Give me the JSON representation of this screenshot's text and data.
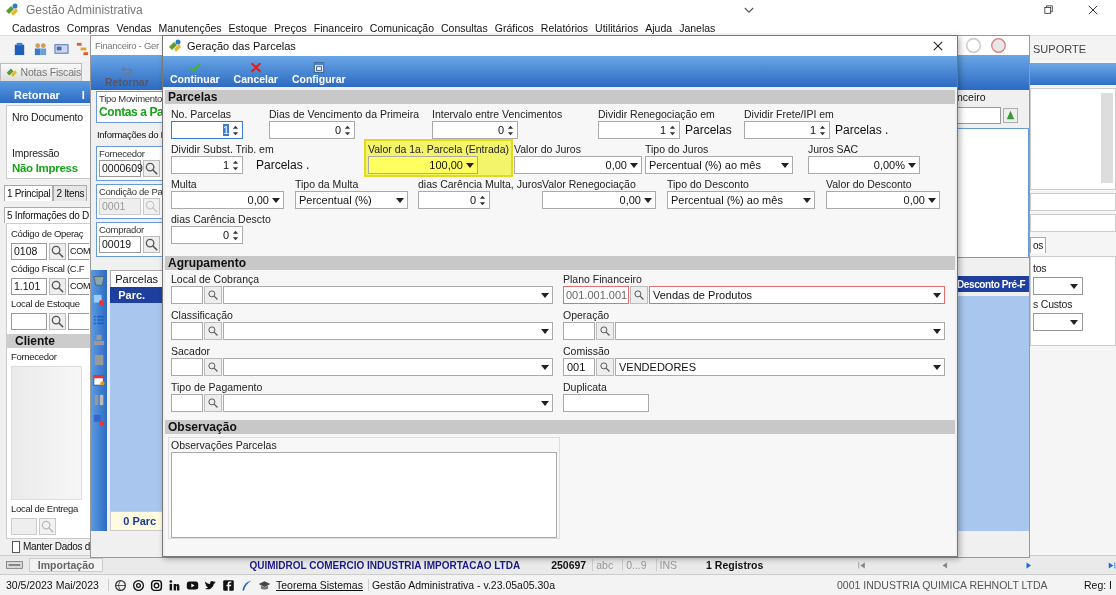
{
  "app": {
    "title": "Gestão Administrativa",
    "menu": [
      "Cadastros",
      "Compras",
      "Vendas",
      "Manutenções",
      "Estoque",
      "Preços",
      "Financeiro",
      "Comunicação",
      "Consultas",
      "Gráficos",
      "Relatórios",
      "Utilitários",
      "Ajuda",
      "Janelas"
    ],
    "support_label": "SUPORTE"
  },
  "notas_fiscais": {
    "title": "Notas Fiscais",
    "toolbar": [
      "Retornar",
      "I"
    ],
    "document_label": "Nro Documento",
    "print_label": "Impressão",
    "print_status": "Não Impress",
    "tabs": [
      {
        "label": "1 Principal",
        "selected": true
      },
      {
        "label": "2 Itens",
        "selected": false
      }
    ],
    "subtab": "5 Informações do D",
    "fields": [
      {
        "label": "Código de Operaç",
        "code": "0108",
        "description": "COM"
      },
      {
        "label": "Código Fiscal (C.F",
        "code": "1.101",
        "description": "COM"
      },
      {
        "label": "Local de Estoque"
      }
    ],
    "section": "Cliente",
    "supplier_label": "Fornecedor",
    "delivery_label": "Local de Entrega",
    "keep_data": {
      "label": "Manter Dados d",
      "checked": false
    },
    "bottom_tab": "Importação"
  },
  "financeiro": {
    "title": "Financeiro - Ger",
    "toolbar_button": "Retornar",
    "movement_label": "Tipo Movimento",
    "movement_value": "Contas a Pa",
    "info_tab": "Informações do I",
    "groups": [
      {
        "label": "Fornecedor",
        "code": "0000609",
        "disabled": false
      },
      {
        "label": "Condição de Pa",
        "code": "0001",
        "disabled": true
      },
      {
        "label": "Comprador",
        "code": "00019",
        "disabled": false
      }
    ],
    "grid_tab": "Parcelas",
    "grid_column": "Parc.",
    "grid_footer": "0 Parc",
    "right_group_label": "nceiro",
    "right_column": "Desconto Pré-F"
  },
  "right_panel": {
    "tab": "os",
    "fields": [
      "tos",
      "s Custos"
    ]
  },
  "dialog": {
    "title": "Geração das Parcelas",
    "toolbar": [
      {
        "label": "Continuar",
        "kind": "confirm"
      },
      {
        "label": "Cancelar",
        "kind": "cancel"
      },
      {
        "label": "Configurar",
        "kind": "configure"
      }
    ],
    "parcelas": {
      "title": "Parcelas",
      "rows": [
        [
          {
            "label": "No. Parcelas",
            "value": "1",
            "kind": "spin",
            "highlighted": false,
            "focused": true
          },
          {
            "label": "Dias de Vencimento da Primeira",
            "value": "0",
            "kind": "spin",
            "highlighted": false,
            "focused": false
          },
          {
            "label": "Intervalo entre Vencimentos",
            "value": "0",
            "kind": "spin",
            "highlighted": false,
            "focused": false
          },
          {
            "label": "Dividir Renegociação em",
            "value": "1",
            "kind": "spin",
            "suffix": "Parcelas",
            "highlighted": false,
            "focused": false
          },
          {
            "label": "Dividir Frete/IPI em",
            "value": "1",
            "kind": "spin",
            "suffix": "Parcelas .",
            "highlighted": false,
            "focused": false
          }
        ],
        [
          {
            "label": "Dividir Subst. Trib. em",
            "value": "1",
            "kind": "spin",
            "suffix": "Parcelas .",
            "highlighted": false,
            "focused": false
          },
          {
            "label": "Valor da 1a. Parcela (Entrada)",
            "value": "100,00",
            "kind": "amount",
            "highlighted": true,
            "focused": false
          },
          {
            "label": "Valor do Juros",
            "value": "0,00",
            "kind": "amount",
            "highlighted": false,
            "focused": false
          },
          {
            "label": "Tipo do Juros",
            "value": "Percentual (%)  ao mês",
            "kind": "select",
            "highlighted": false,
            "focused": false
          },
          {
            "label": "Juros SAC",
            "value": "0,00%",
            "kind": "amount",
            "highlighted": false,
            "focused": false
          }
        ],
        [
          {
            "label": "Multa",
            "value": "0,00",
            "kind": "amount",
            "highlighted": false,
            "focused": false
          },
          {
            "label": "Tipo da Multa",
            "value": "Percentual (%)",
            "kind": "select",
            "highlighted": false,
            "focused": false
          },
          {
            "label": "dias Carência Multa, Juros",
            "value": "0",
            "kind": "spin",
            "highlighted": false,
            "focused": false
          },
          {
            "label": "Valor Renegociação",
            "value": "0,00",
            "kind": "amount",
            "highlighted": false,
            "focused": false
          },
          {
            "label": "Tipo do Desconto",
            "value": "Percentual (%) ao mês",
            "kind": "select",
            "highlighted": false,
            "focused": false
          },
          {
            "label": "Valor do Desconto",
            "value": "0,00",
            "kind": "amount",
            "highlighted": false,
            "focused": false
          }
        ],
        [
          {
            "label": "dias Carência Descto",
            "value": "0",
            "kind": "spin",
            "highlighted": false,
            "focused": false
          }
        ]
      ]
    },
    "agrupamento": {
      "title": "Agrupamento",
      "left": [
        {
          "label": "Local de Cobrança",
          "required": false
        },
        {
          "label": "Classificação",
          "required": false
        },
        {
          "label": "Sacador",
          "required": false
        },
        {
          "label": "Tipo de Pagamento",
          "required": false
        }
      ],
      "right": [
        {
          "label": "Plano Financeiro",
          "code": "001.001.001",
          "description": "Vendas de Produtos",
          "required": true
        },
        {
          "label": "Operação",
          "required": false
        },
        {
          "label": "Comissão",
          "code": "001",
          "description": "VENDEDORES",
          "required": false
        }
      ],
      "duplicata_label": "Duplicata"
    },
    "observacao": {
      "title": "Observação",
      "group_label": "Observações Parcelas"
    }
  },
  "record_bar": {
    "company": "QUIMIDROL COMERCIO INDUSTRIA IMPORTACAO LTDA",
    "number": "250697",
    "indicators": [
      "abc",
      "0...9",
      "INS"
    ],
    "count": "1 Registros"
  },
  "status_bar": {
    "date": "30/5/2023 Mai/2023",
    "link": "Teorema Sistemas",
    "version": "Gestão Administrativa - v.23.05a05.30a",
    "company": "0001 INDUSTRIA QUIMICA REHNOLT LTDA",
    "register": "Reg: I"
  }
}
